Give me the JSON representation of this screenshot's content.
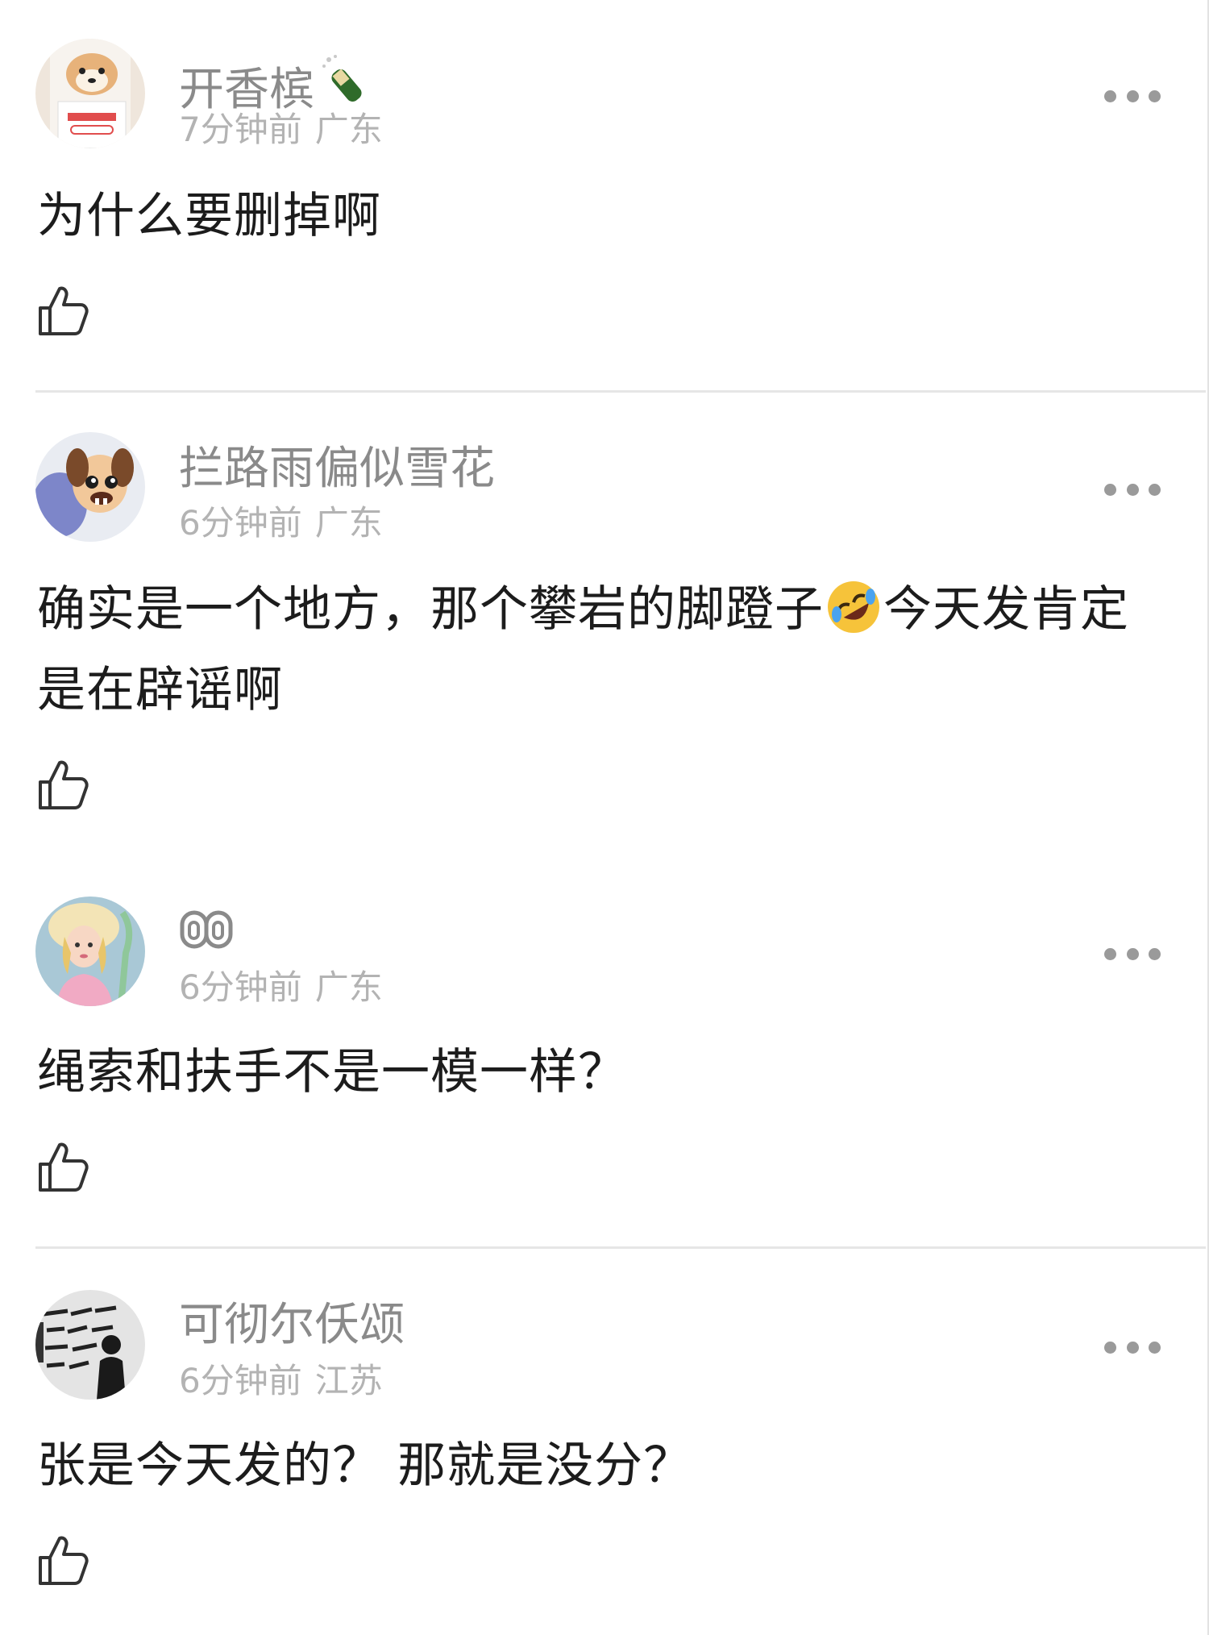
{
  "comments": [
    {
      "username": "开香槟",
      "time": "7分钟前",
      "location": "广东",
      "text": "为什么要删掉啊",
      "avatar_icon": "shiba-dog-respect-avatar"
    },
    {
      "username": "拦路雨偏似雪花",
      "time": "6分钟前",
      "location": "广东",
      "text_before_emoji": "确实是一个地方，那个攀岩的脚蹬子",
      "emoji": "rolling-laughing-emoji",
      "text_after_emoji": "今天发肯定是在辟谣啊",
      "avatar_icon": "cartoon-dog-avatar"
    },
    {
      "username_icon": "infinity-eyes-glyph",
      "time": "6分钟前",
      "location": "广东",
      "text": "绳索和扶手不是一模一样？",
      "avatar_icon": "bo-peep-avatar"
    },
    {
      "username": "可彻尔仸颂",
      "time": "6分钟前",
      "location": "江苏",
      "text": "张是今天发的？ 那就是没分？",
      "avatar_icon": "im-out-of-bed-avatar"
    }
  ],
  "colors": {
    "username": "#8a8a8a",
    "meta": "#b3b3b3",
    "body": "#1c1c1c",
    "divider": "#e6e6e6"
  }
}
